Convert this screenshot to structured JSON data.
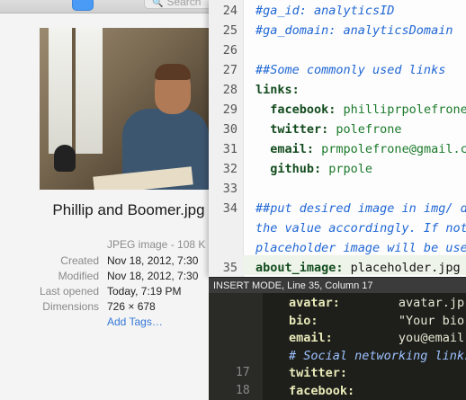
{
  "finder": {
    "search_placeholder": "Search",
    "filename": "Phillip and Boomer.jpg",
    "kind": "JPEG image - 108 K",
    "meta": [
      {
        "label": "Created",
        "value": "Nov 18, 2012, 7:30"
      },
      {
        "label": "Modified",
        "value": "Nov 18, 2012, 7:30"
      },
      {
        "label": "Last opened",
        "value": "Today, 7:19 PM"
      },
      {
        "label": "Dimensions",
        "value": "726 × 678"
      }
    ],
    "add_tags": "Add Tags…"
  },
  "editor": {
    "lines": [
      {
        "n": "24",
        "parts": [
          {
            "t": "#ga_id: analyticsID",
            "c": "cmt"
          }
        ]
      },
      {
        "n": "25",
        "parts": [
          {
            "t": "#ga_domain: analyticsDomain",
            "c": "cmt"
          }
        ]
      },
      {
        "n": "26",
        "parts": []
      },
      {
        "n": "27",
        "parts": [
          {
            "t": "##Some commonly used links",
            "c": "cmt"
          }
        ]
      },
      {
        "n": "28",
        "parts": [
          {
            "t": "links:",
            "c": "key"
          }
        ]
      },
      {
        "n": "29",
        "parts": [
          {
            "t": "  facebook:",
            "c": "key"
          },
          {
            "t": " philliprpolefrone",
            "c": "val"
          }
        ]
      },
      {
        "n": "30",
        "parts": [
          {
            "t": "  twitter:",
            "c": "key"
          },
          {
            "t": " polefrone",
            "c": "val"
          }
        ]
      },
      {
        "n": "31",
        "parts": [
          {
            "t": "  email:",
            "c": "key"
          },
          {
            "t": " prmpolefrone@gmail.com",
            "c": "val"
          }
        ]
      },
      {
        "n": "32",
        "parts": [
          {
            "t": "  github:",
            "c": "key"
          },
          {
            "t": " prpole",
            "c": "val"
          }
        ]
      },
      {
        "n": "33",
        "parts": []
      },
      {
        "n": "34",
        "parts": [
          {
            "t": "##put desired image in img/ di",
            "c": "cmt"
          }
        ]
      },
      {
        "n": "",
        "parts": [
          {
            "t": "the value accordingly. If not",
            "c": "cmt"
          }
        ]
      },
      {
        "n": "",
        "parts": [
          {
            "t": "placeholder image will be used",
            "c": "cmt"
          }
        ]
      },
      {
        "n": "35",
        "parts": [
          {
            "t": "about_image:",
            "c": "key"
          },
          {
            "t": " placeholder.jpg",
            "c": "plain"
          }
        ]
      }
    ]
  },
  "status": {
    "text": "INSERT MODE, Line 35, Column 17"
  },
  "bg_editor": {
    "lines": [
      {
        "n": "",
        "parts": [
          {
            "t": "avatar:",
            "c": "bkey"
          },
          {
            "t": "        avatar.jp",
            "c": "bstr"
          }
        ]
      },
      {
        "n": "",
        "parts": [
          {
            "t": "bio:",
            "c": "bkey"
          },
          {
            "t": "           \"Your bio",
            "c": "bstr"
          }
        ]
      },
      {
        "n": "",
        "parts": [
          {
            "t": "email:",
            "c": "bkey"
          },
          {
            "t": "         you@email",
            "c": "bstr"
          }
        ]
      },
      {
        "n": "",
        "parts": [
          {
            "t": "# Social networking links",
            "c": "bcmt"
          }
        ]
      },
      {
        "n": "17",
        "parts": [
          {
            "t": "twitter:",
            "c": "bkey"
          }
        ]
      },
      {
        "n": "18",
        "parts": [
          {
            "t": "facebook:",
            "c": "bkey"
          }
        ]
      }
    ]
  }
}
